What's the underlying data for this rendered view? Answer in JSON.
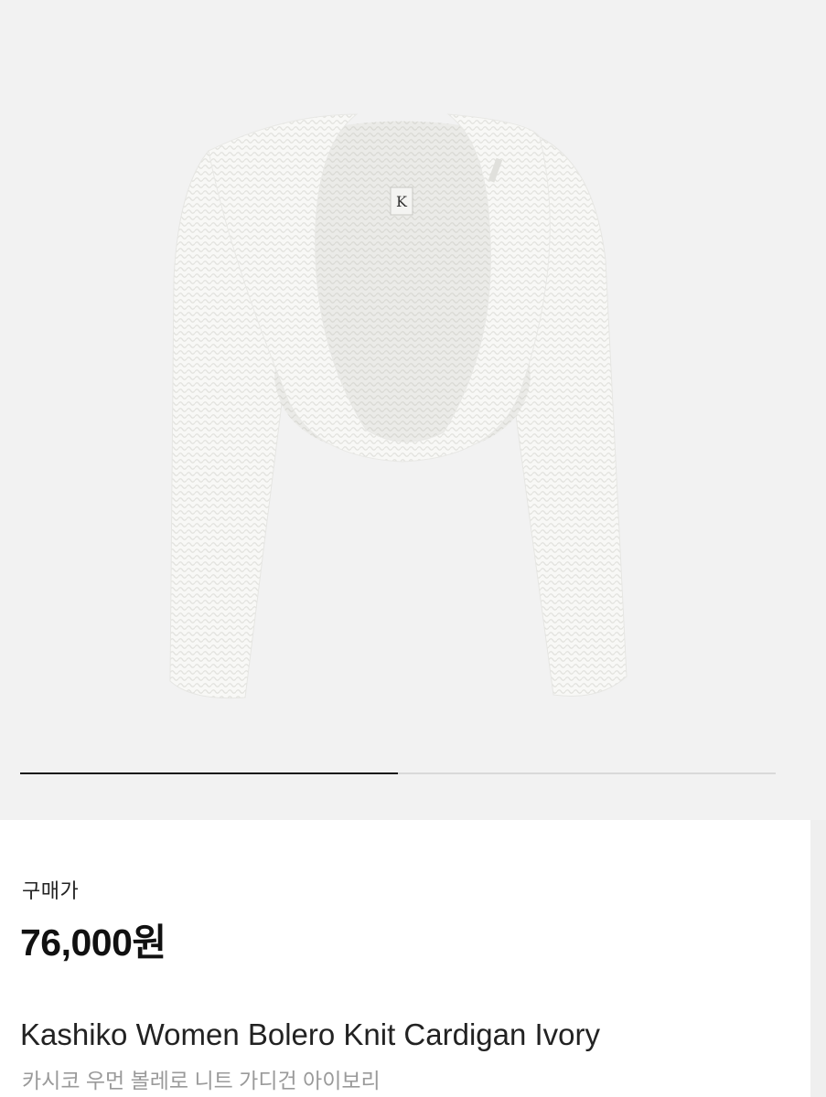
{
  "gallery": {
    "image": "product-photo-white-bolero-knit-cardigan",
    "logo_mark": "K",
    "pager": {
      "current": 1,
      "total": 2,
      "progress": 0.5
    }
  },
  "info": {
    "price_label": "구매가",
    "price": "76,000원",
    "name_en": "Kashiko Women Bolero Knit Cardigan Ivory",
    "name_ko": "카시코 우먼 볼레로 니트 가디건 아이보리"
  },
  "colors": {
    "background": "#f2f2f2",
    "panel": "#ffffff",
    "text": "#111111",
    "subtext": "#9a9a9a",
    "pager_active": "#1a1a1a",
    "pager_track": "#d9d9d9"
  }
}
